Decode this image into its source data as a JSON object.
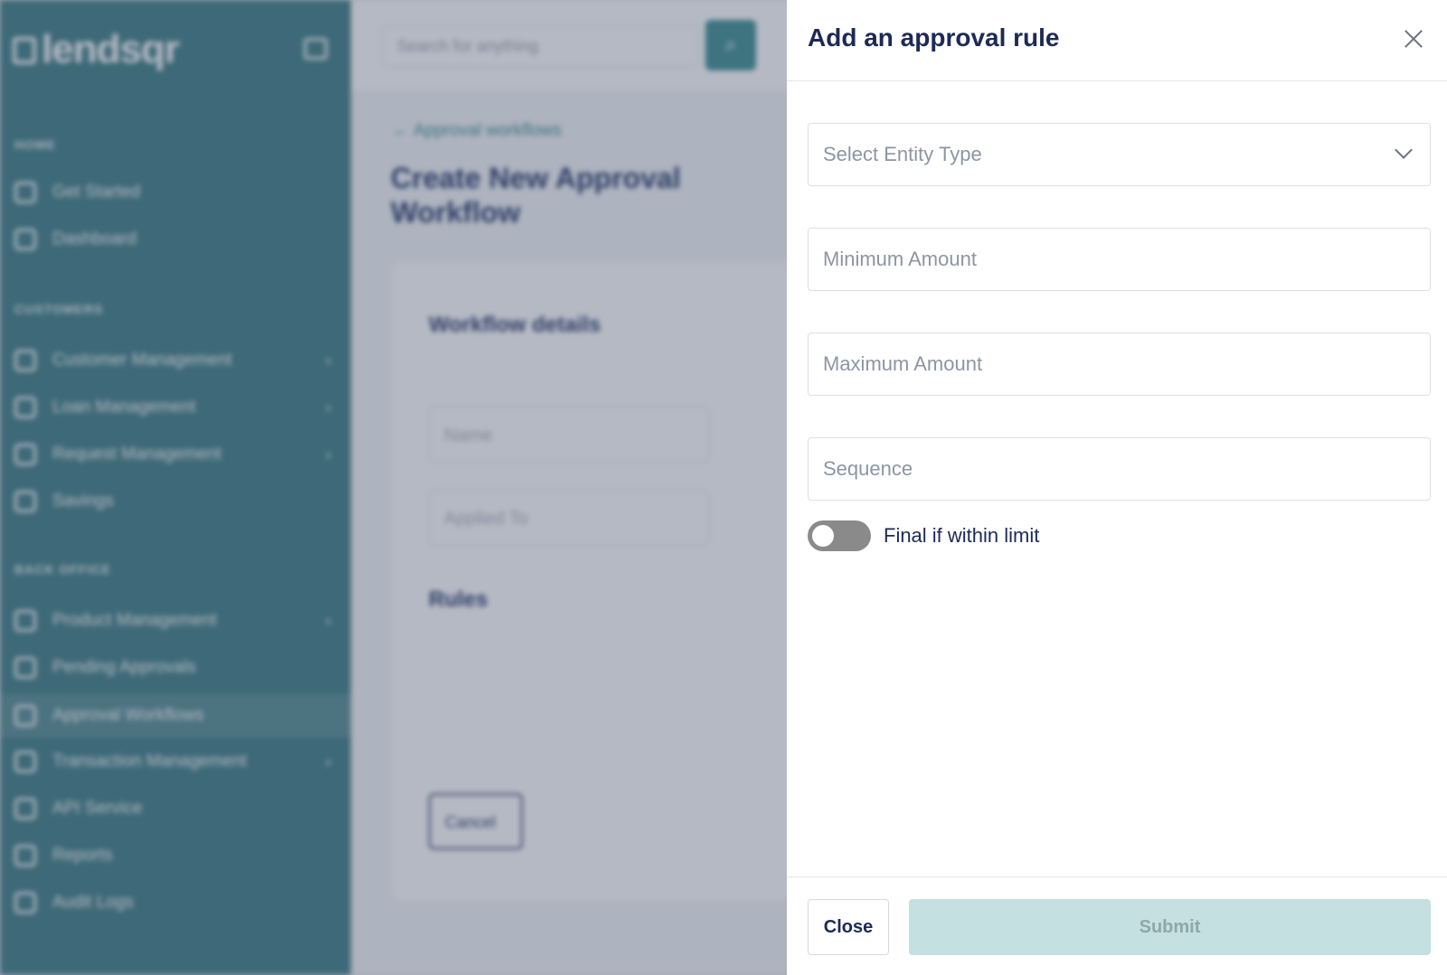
{
  "app": {
    "logo": "lendsqr",
    "search_placeholder": "Search for anything",
    "sidebar": {
      "sections": [
        {
          "title": "HOME",
          "items": [
            {
              "label": "Get Started"
            },
            {
              "label": "Dashboard"
            }
          ]
        },
        {
          "title": "CUSTOMERS",
          "items": [
            {
              "label": "Customer Management"
            },
            {
              "label": "Loan Management"
            },
            {
              "label": "Request Management"
            },
            {
              "label": "Savings"
            }
          ]
        },
        {
          "title": "BACK OFFICE",
          "items": [
            {
              "label": "Product Management"
            },
            {
              "label": "Pending Approvals"
            },
            {
              "label": "Approval Workflows"
            },
            {
              "label": "Transaction Management"
            },
            {
              "label": "API Service"
            },
            {
              "label": "Reports"
            },
            {
              "label": "Audit Logs"
            }
          ]
        }
      ]
    },
    "main": {
      "back_link": "Approval workflows",
      "page_title": "Create New Approval Workflow",
      "workflow_details_heading": "Workflow details",
      "name_placeholder": "Name",
      "applied_to_placeholder": "Applied To",
      "rules_heading": "Rules",
      "cancel_label": "Cancel"
    }
  },
  "drawer": {
    "title": "Add an approval rule",
    "entity_type_placeholder": "Select Entity Type",
    "min_amount_placeholder": "Minimum Amount",
    "max_amount_placeholder": "Maximum Amount",
    "sequence_placeholder": "Sequence",
    "final_toggle_label": "Final if within limit",
    "final_toggle_on": false,
    "close_label": "Close",
    "submit_label": "Submit"
  },
  "colors": {
    "sidebar": "#3f7f86",
    "accent": "#3f8f94",
    "title_text": "#1d2a55",
    "submit_disabled_bg": "#c5e0e0",
    "toggle_off": "#8a8a8a"
  }
}
